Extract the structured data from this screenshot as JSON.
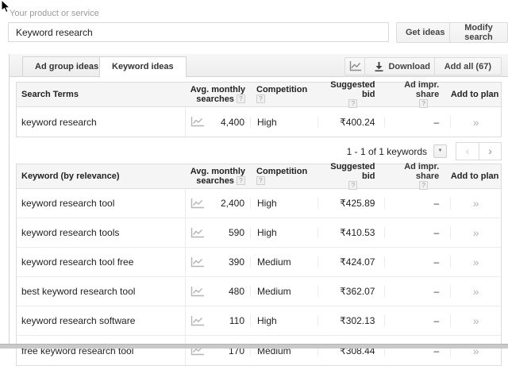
{
  "search": {
    "label": "Your product or service",
    "value": "Keyword research",
    "get_ideas": "Get ideas",
    "modify_search": "Modify search"
  },
  "tabs": {
    "ad_group": "Ad group ideas",
    "keyword": "Keyword ideas"
  },
  "toolbar": {
    "download": "Download",
    "add_all": "Add all (67)"
  },
  "columns": {
    "avg_line1": "Avg. monthly",
    "avg_line2": "searches",
    "competition": "Competition",
    "bid": "Suggested bid",
    "impr": "Ad impr. share",
    "plan": "Add to plan"
  },
  "tables": {
    "search_terms": {
      "first_col": "Search Terms",
      "rows": [
        {
          "keyword": "keyword research",
          "searches": "4,400",
          "competition": "High",
          "bid": "₹400.24",
          "impr": "–"
        }
      ]
    },
    "keyword_ideas": {
      "first_col": "Keyword (by relevance)",
      "rows": [
        {
          "keyword": "keyword research tool",
          "searches": "2,400",
          "competition": "High",
          "bid": "₹425.89",
          "impr": "–"
        },
        {
          "keyword": "keyword research tools",
          "searches": "590",
          "competition": "High",
          "bid": "₹410.53",
          "impr": "–"
        },
        {
          "keyword": "keyword research tool free",
          "searches": "390",
          "competition": "Medium",
          "bid": "₹424.07",
          "impr": "–"
        },
        {
          "keyword": "best keyword research tool",
          "searches": "480",
          "competition": "Medium",
          "bid": "₹362.07",
          "impr": "–"
        },
        {
          "keyword": "keyword research software",
          "searches": "110",
          "competition": "High",
          "bid": "₹302.13",
          "impr": "–"
        },
        {
          "keyword": "free keyword research tool",
          "searches": "170",
          "competition": "Medium",
          "bid": "₹308.44",
          "impr": "–"
        }
      ]
    }
  },
  "pagination": {
    "label": "1 - 1 of 1 keywords"
  },
  "icons": {
    "help": "?",
    "add_to_plan": "»",
    "dropdown": "▼",
    "prev": "‹",
    "next": "›"
  },
  "colors": {
    "border": "#dcdcdc",
    "header_bg": "#f5f5f5",
    "text": "#222222",
    "muted": "#9a9a9a"
  }
}
